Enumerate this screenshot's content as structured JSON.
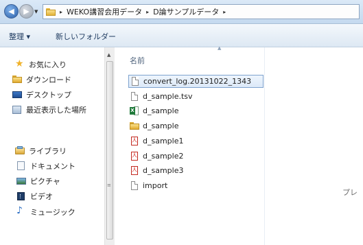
{
  "address_bar": {
    "breadcrumbs": [
      "WEKO講習会用データ",
      "D論サンプルデータ"
    ],
    "separator": "▸",
    "icons": {
      "back": "back-arrow-icon",
      "forward": "forward-arrow-icon",
      "folder": "folder-icon"
    }
  },
  "toolbar": {
    "organize_label": "整理 ▾",
    "new_folder_label": "新しいフォルダー"
  },
  "nav_pane": {
    "favorites": {
      "label": "お気に入り",
      "icon": "star-icon",
      "items": [
        {
          "label": "ダウンロード",
          "icon": "downloads-folder-icon"
        },
        {
          "label": "デスクトップ",
          "icon": "desktop-icon"
        },
        {
          "label": "最近表示した場所",
          "icon": "recent-places-icon"
        }
      ]
    },
    "libraries": {
      "label": "ライブラリ",
      "icon": "library-icon",
      "items": [
        {
          "label": "ドキュメント",
          "icon": "documents-icon"
        },
        {
          "label": "ピクチャ",
          "icon": "pictures-icon"
        },
        {
          "label": "ビデオ",
          "icon": "videos-icon"
        },
        {
          "label": "ミュージック",
          "icon": "music-icon"
        }
      ]
    }
  },
  "file_list": {
    "column_name": "名前",
    "files": [
      {
        "name": "convert_log.20131022_1343",
        "icon": "text-file-icon",
        "selected": true
      },
      {
        "name": "d_sample.tsv",
        "icon": "text-file-icon"
      },
      {
        "name": "d_sample",
        "icon": "excel-file-icon"
      },
      {
        "name": "d_sample",
        "icon": "folder-icon"
      },
      {
        "name": "d_sample1",
        "icon": "pdf-file-icon"
      },
      {
        "name": "d_sample2",
        "icon": "pdf-file-icon"
      },
      {
        "name": "d_sample3",
        "icon": "pdf-file-icon"
      },
      {
        "name": "import",
        "icon": "text-file-icon"
      }
    ]
  },
  "preview_pane": {
    "text": "プレ"
  },
  "colors": {
    "selection_border": "#7da2ce",
    "toolbar_text": "#1e3a5f",
    "header_text": "#4c607a"
  }
}
